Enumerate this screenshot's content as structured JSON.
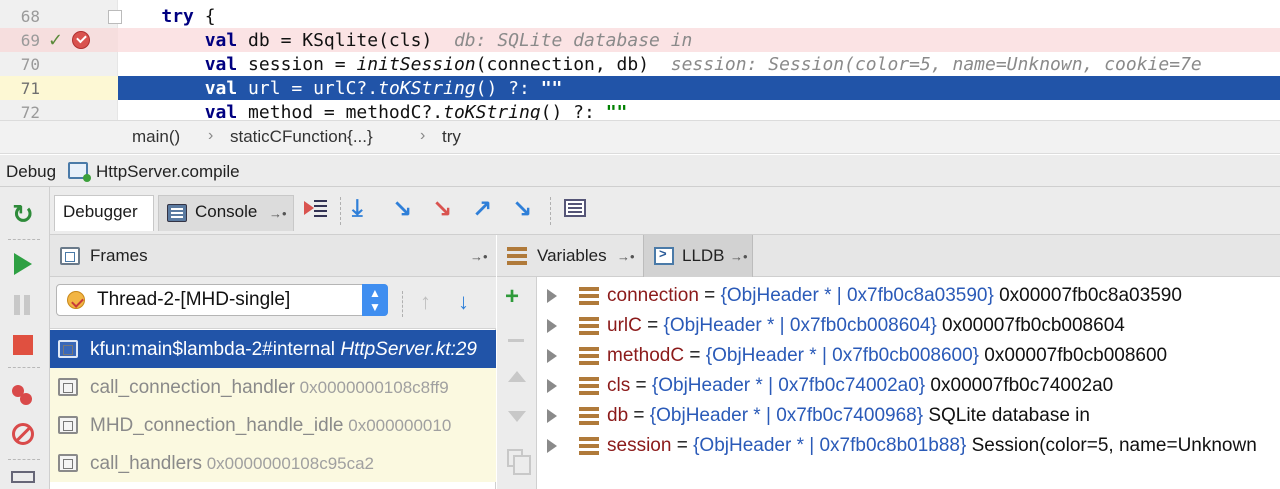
{
  "editor": {
    "lines": [
      {
        "num": "68",
        "indent": "    ",
        "parts": [
          {
            "c": "kw",
            "t": "try"
          },
          {
            "c": "",
            "t": " {"
          }
        ]
      },
      {
        "num": "69",
        "indent": "        ",
        "parts": [
          {
            "c": "kw",
            "t": "val"
          },
          {
            "c": "",
            "t": " db = KSqlite(cls)  "
          },
          {
            "c": "hint",
            "t": "db: SQLite database in"
          }
        ]
      },
      {
        "num": "70",
        "indent": "        ",
        "parts": [
          {
            "c": "kw",
            "t": "val"
          },
          {
            "c": "",
            "t": " session = "
          },
          {
            "c": "fn",
            "t": "initSession"
          },
          {
            "c": "",
            "t": "(connection, db)  "
          },
          {
            "c": "hint",
            "t": "session: Session(color=5, name=Unknown, cookie=7e"
          }
        ]
      },
      {
        "num": "71",
        "indent": "        ",
        "parts": [
          {
            "c": "kw",
            "t": "val"
          },
          {
            "c": "",
            "t": " url = urlC?."
          },
          {
            "c": "fn",
            "t": "toKString"
          },
          {
            "c": "",
            "t": "() ?: "
          },
          {
            "c": "str",
            "t": "\"\""
          }
        ]
      },
      {
        "num": "72",
        "indent": "        ",
        "parts": [
          {
            "c": "kw",
            "t": "val"
          },
          {
            "c": "",
            "t": " method = methodC?."
          },
          {
            "c": "fn",
            "t": "toKString"
          },
          {
            "c": "",
            "t": "() ?: "
          },
          {
            "c": "str",
            "t": "\"\""
          }
        ]
      }
    ],
    "check_icon": "check-icon",
    "breakpoint_icon": "breakpoint-check-icon"
  },
  "breadcrumb": {
    "items": [
      "main()",
      "staticCFunction{...}",
      "try"
    ],
    "separator": "›"
  },
  "debug_bar": {
    "title": "Debug",
    "config": "HttpServer.compile"
  },
  "tabs": {
    "debugger": "Debugger",
    "console": "Console",
    "pin": "→•"
  },
  "frames": {
    "title": "Frames",
    "pin": "→•",
    "thread": "Thread-2-[MHD-single]",
    "items": [
      {
        "name": "kfun:main$lambda-2#internal",
        "loc": " HttpServer.kt:29",
        "addr": ""
      },
      {
        "name": "call_connection_handler",
        "loc": "",
        "addr": " 0x0000000108c8ff9"
      },
      {
        "name": "MHD_connection_handle_idle",
        "loc": "",
        "addr": " 0x000000010"
      },
      {
        "name": "call_handlers",
        "loc": "",
        "addr": " 0x0000000108c95ca2"
      }
    ]
  },
  "variables": {
    "tab_variables": "Variables",
    "tab_lldb": "LLDB",
    "pin": "→•",
    "items": [
      {
        "name": "connection",
        "type": "{ObjHeader * | 0x7fb0c8a03590}",
        "value": " 0x00007fb0c8a03590"
      },
      {
        "name": "urlC",
        "type": "{ObjHeader * | 0x7fb0cb008604}",
        "value": " 0x00007fb0cb008604"
      },
      {
        "name": "methodC",
        "type": "{ObjHeader * | 0x7fb0cb008600}",
        "value": " 0x00007fb0cb008600"
      },
      {
        "name": "cls",
        "type": "{ObjHeader * | 0x7fb0c74002a0}",
        "value": " 0x00007fb0c74002a0"
      },
      {
        "name": "db",
        "type": "{ObjHeader * | 0x7fb0c7400968}",
        "value": " SQLite database in"
      },
      {
        "name": "session",
        "type": "{ObjHeader * | 0x7fb0c8b01b88}",
        "value": " Session(color=5, name=Unknown"
      }
    ]
  },
  "colors": {
    "selection": "#2154a8",
    "breakpoint_line": "#fbe3e4",
    "frames_bg": "#fbf9e0",
    "var_name": "#8b1a1a",
    "var_type": "#2a5ab8"
  }
}
